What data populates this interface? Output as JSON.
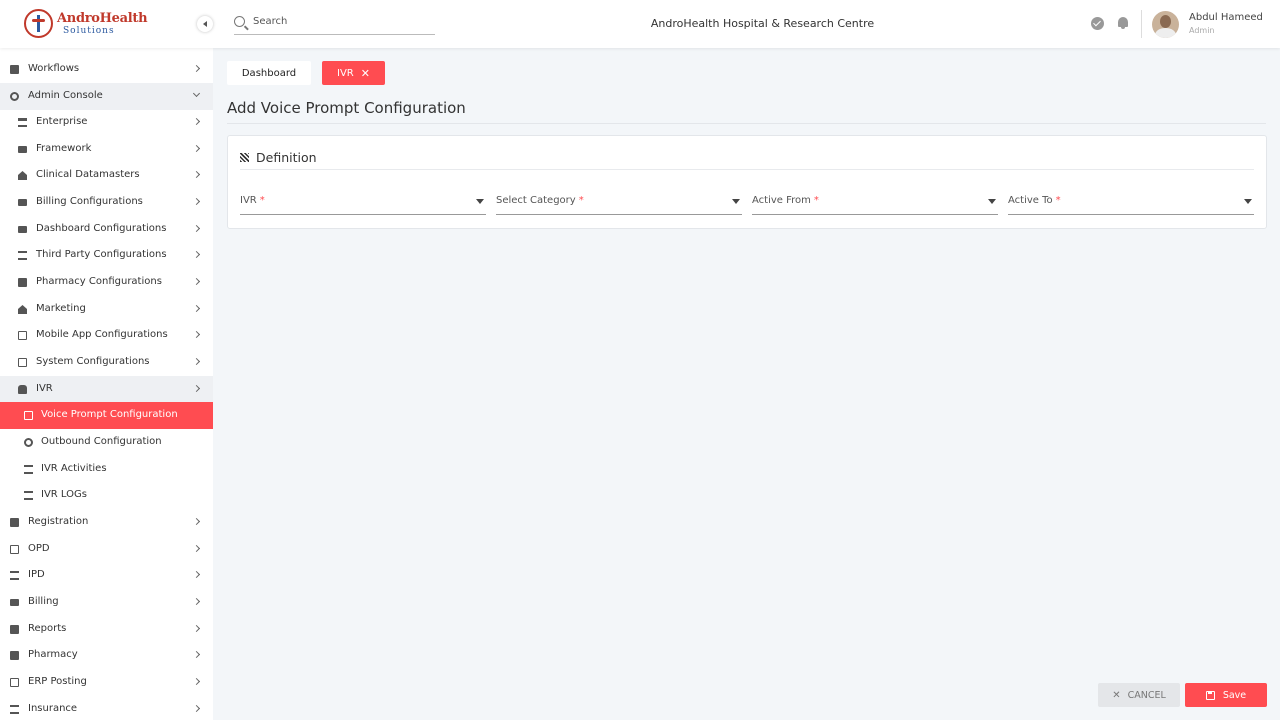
{
  "brand": {
    "title": "AndroHealth",
    "subtitle": "Solutions"
  },
  "search": {
    "placeholder": "Search"
  },
  "header": {
    "hospital_name": "AndroHealth Hospital & Research Centre"
  },
  "user": {
    "name": "Abdul Hameed",
    "role": "Admin"
  },
  "sidebar": {
    "items": [
      {
        "label": "Workflows",
        "icon": "monitor-icon"
      },
      {
        "label": "Admin Console",
        "icon": "gear-icon",
        "expanded": true
      },
      {
        "label": "Enterprise",
        "icon": "bank-icon"
      },
      {
        "label": "Framework",
        "icon": "card-icon"
      },
      {
        "label": "Clinical Datamasters",
        "icon": "home-icon"
      },
      {
        "label": "Billing Configurations",
        "icon": "card-icon"
      },
      {
        "label": "Dashboard Configurations",
        "icon": "card-icon"
      },
      {
        "label": "Third Party Configurations",
        "icon": "link-icon"
      },
      {
        "label": "Pharmacy Configurations",
        "icon": "medkit-icon"
      },
      {
        "label": "Marketing",
        "icon": "megaphone-icon"
      },
      {
        "label": "Mobile App Configurations",
        "icon": "phone-icon"
      },
      {
        "label": "System Configurations",
        "icon": "id-card-icon"
      },
      {
        "label": "IVR",
        "icon": "hand-icon",
        "expanded": true
      },
      {
        "label": "Voice Prompt Configuration",
        "icon": "document-icon",
        "active": true
      },
      {
        "label": "Outbound Configuration",
        "icon": "record-icon"
      },
      {
        "label": "IVR Activities",
        "icon": "table-icon"
      },
      {
        "label": "IVR LOGs",
        "icon": "list-icon"
      },
      {
        "label": "Registration",
        "icon": "checkbox-icon"
      },
      {
        "label": "OPD",
        "icon": "building-icon"
      },
      {
        "label": "IPD",
        "icon": "bed-icon"
      },
      {
        "label": "Billing",
        "icon": "card-icon"
      },
      {
        "label": "Reports",
        "icon": "report-icon"
      },
      {
        "label": "Pharmacy",
        "icon": "medkit-icon"
      },
      {
        "label": "ERP Posting",
        "icon": "presentation-icon"
      },
      {
        "label": "Insurance",
        "icon": "family-icon"
      }
    ]
  },
  "tabs": [
    {
      "label": "Dashboard"
    },
    {
      "label": "IVR",
      "close": "✕"
    }
  ],
  "page": {
    "title": "Add Voice Prompt Configuration",
    "section_title": "Definition",
    "fields": [
      {
        "label": "IVR",
        "required": "*"
      },
      {
        "label": "Select Category",
        "required": "*"
      },
      {
        "label": "Active From",
        "required": "*"
      },
      {
        "label": "Active To",
        "required": "*"
      }
    ]
  },
  "actions": {
    "cancel_label": "CANCEL",
    "cancel_icon": "✕",
    "save_label": "Save"
  },
  "colors": {
    "accent": "#ff4c51",
    "background": "#f3f6f9",
    "brand_red": "#c0392b",
    "brand_blue": "#2c5aa0"
  }
}
